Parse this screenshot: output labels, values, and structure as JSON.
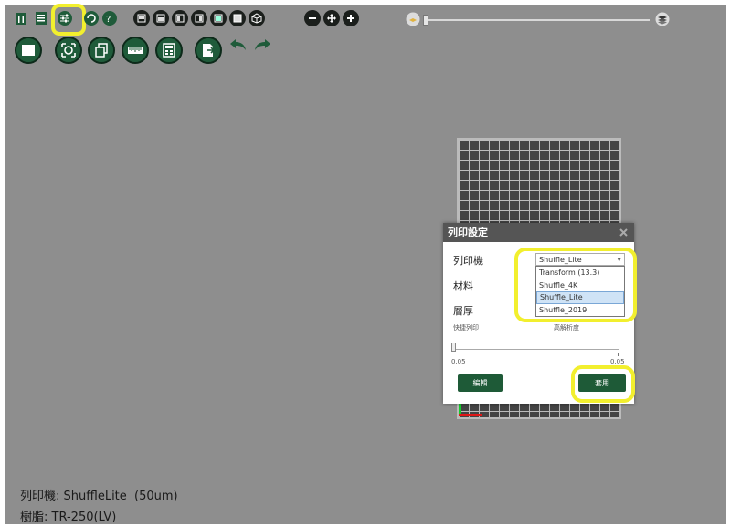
{
  "toolbar": {
    "top_row": [
      "delete-icon",
      "list-icon",
      "settings-sliders-icon",
      "refresh-icon",
      "help-icon",
      "view-front-icon",
      "view-back-icon",
      "view-left-icon",
      "view-right-icon",
      "view-top-icon",
      "view-bottom-icon",
      "view-iso-icon",
      "zoom-out-icon",
      "move-icon",
      "zoom-in-icon"
    ],
    "bottom_row": [
      "open-file-icon",
      "fit-view-icon",
      "duplicate-icon",
      "ruler-icon",
      "calculator-icon",
      "export-icon",
      "undo-icon",
      "redo-icon"
    ]
  },
  "layer_slider": {
    "start_icon": "layer-bottom-icon",
    "end_icon": "layers-top-icon"
  },
  "dialog": {
    "title": "列印設定",
    "printer_label": "列印機",
    "material_label": "材料",
    "layer_label": "層厚",
    "selected_printer": "Shuffle_Lite",
    "options": [
      "Transform (13.3)",
      "Shuffle_4K",
      "Shuffle_Lite",
      "Shuffle_2019"
    ],
    "fast_print_label": "快捷列印",
    "high_res_label": "高解析度",
    "slider_min": "0.05",
    "slider_max": "0.05",
    "edit_button": "編輯",
    "apply_button": "套用"
  },
  "status": {
    "printer_label": "列印機:",
    "printer_value": "ShuffleLite  (50um)",
    "resin_label": "樹脂:",
    "resin_value": "TR-250(LV)"
  },
  "colors": {
    "accent_green": "#1e5a37",
    "highlight": "#f2ef2e",
    "background": "#8e8e8e"
  }
}
